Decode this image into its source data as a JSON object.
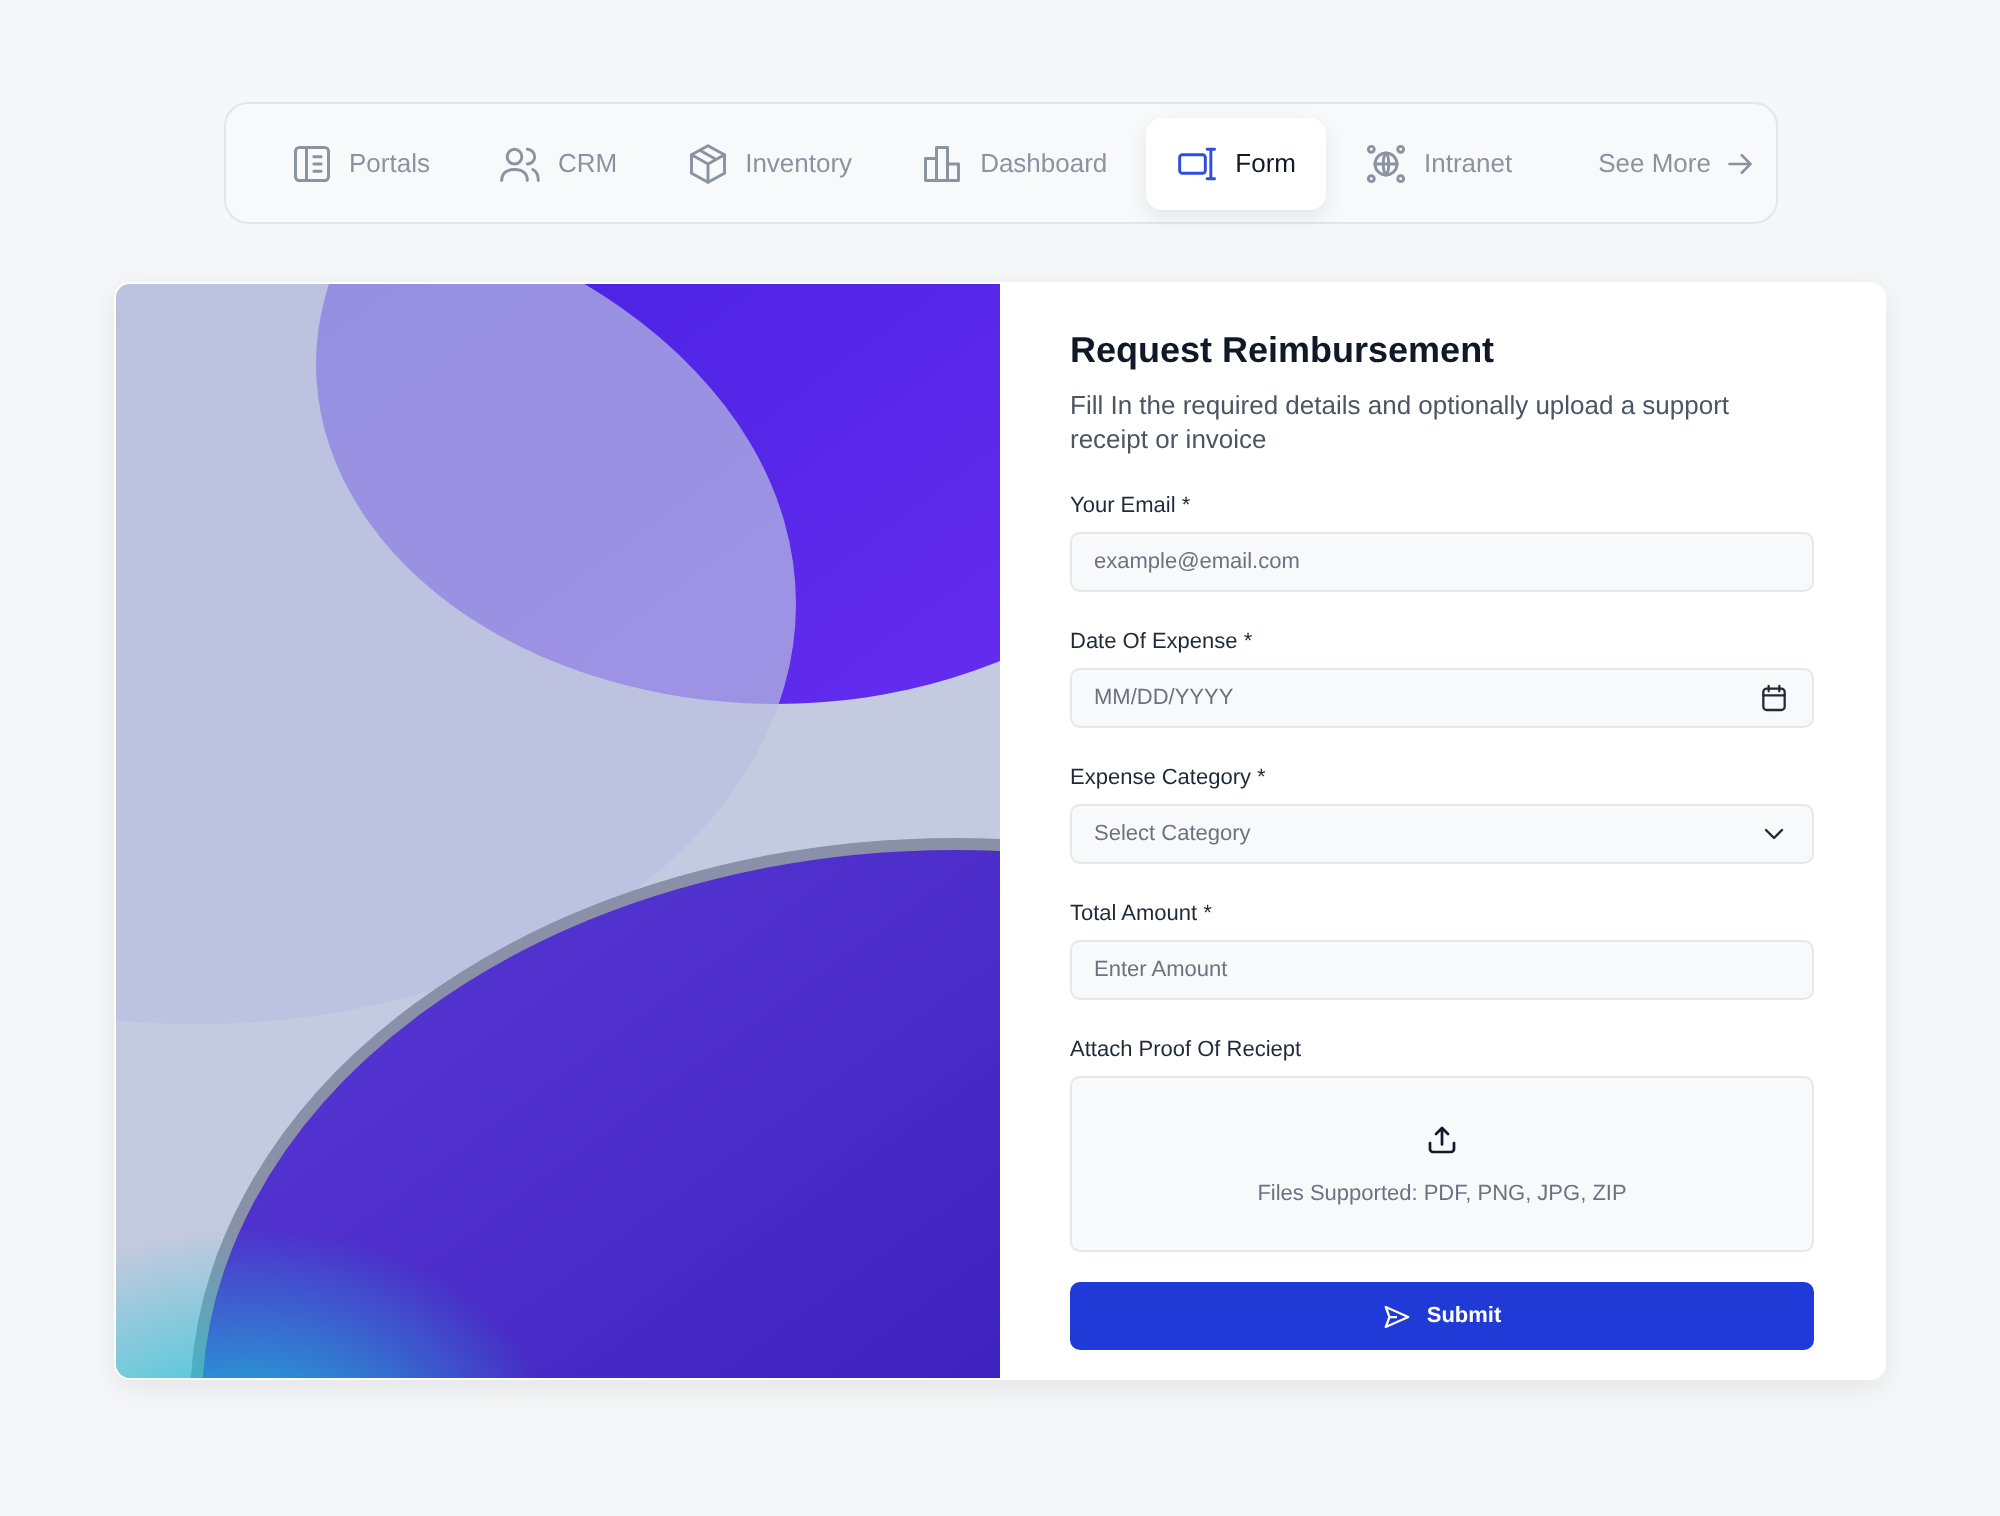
{
  "nav": {
    "tabs": [
      {
        "label": "Portals",
        "selected": false
      },
      {
        "label": "CRM",
        "selected": false
      },
      {
        "label": "Inventory",
        "selected": false
      },
      {
        "label": "Dashboard",
        "selected": false
      },
      {
        "label": "Form",
        "selected": true
      },
      {
        "label": "Intranet",
        "selected": false
      }
    ],
    "more": "See More"
  },
  "form": {
    "title": "Request Reimbursement",
    "subtitle": "Fill In the required details and optionally upload a support receipt or invoice",
    "fields": [
      {
        "kind": "text",
        "label": "Your Email *",
        "placeholder": "example@email.com"
      },
      {
        "kind": "date",
        "label": "Date Of Expense *",
        "placeholder": "MM/DD/YYYY"
      },
      {
        "kind": "select",
        "label": "Expense Category *",
        "placeholder": "Select Category"
      },
      {
        "kind": "text",
        "label": "Total Amount *",
        "placeholder": "Enter Amount"
      },
      {
        "kind": "upload",
        "label": "Attach Proof Of Reciept",
        "hint": "Files Supported: PDF, PNG, JPG, ZIP"
      }
    ],
    "submit": "Submit"
  }
}
